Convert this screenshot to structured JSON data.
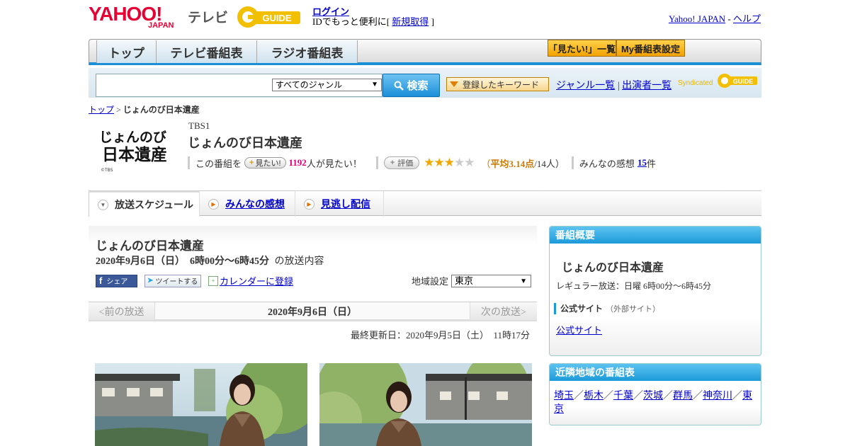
{
  "header": {
    "logo_yahoo": "YAHOO!",
    "logo_japan": "JAPAN",
    "logo_tv": "テレビ",
    "gguide": "GUIDE",
    "login": "ログイン",
    "id_text_before": "IDでもっと便利に[ ",
    "id_link": "新規取得",
    "id_text_after": " ]",
    "yahoo_japan": "Yahoo! JAPAN",
    "dash": " - ",
    "help": "ヘルプ"
  },
  "nav": {
    "tabs": [
      "トップ",
      "テレビ番組表",
      "ラジオ番組表"
    ],
    "mitai_list": "「見たい!」一覧",
    "my_settings": "My番組表設定"
  },
  "search": {
    "genre_select": "すべてのジャンル",
    "button": "検索",
    "keyword_btn": "登録したキーワード",
    "genre_list": "ジャンル一覧",
    "divider": " | ",
    "cast_list": "出演者一覧",
    "syndicated": "Syndicated"
  },
  "breadcrumb": {
    "home": "トップ",
    "sep": " > ",
    "current": "じょんのび日本遺産"
  },
  "program": {
    "logo_text": "じょんのび日本遺産",
    "copyright": "©TBS",
    "channel": "TBS1",
    "title": "じょんのび日本遺産",
    "this_program": "この番組を",
    "mitai_btn": "見たい!",
    "mitai_count": "1192",
    "mitai_suffix": "人が見たい！",
    "eval_btn": "評価",
    "rating": 3.14,
    "avg_open": "（",
    "avg_label": "平均3.14点",
    "avg_rest": "/14人）",
    "impressions_label": "みんなの感想",
    "impressions_count": "15",
    "impressions_unit": "件"
  },
  "tabs": {
    "schedule": "放送スケジュール",
    "impressions": "みんなの感想",
    "missed": "見逃し配信"
  },
  "main": {
    "title": "じょんのび日本遺産",
    "date_bold": "2020年9月6日（日）　6時00分～6時45分",
    "date_suffix": "の放送内容",
    "fb": "シェア",
    "tweet": "ツイートする",
    "calendar": "カレンダーに登録",
    "region_label": "地域設定",
    "region_value": "東京",
    "prev": "<前の放送",
    "current_date": "2020年9月6日（日）",
    "next": "次の放送>",
    "updated": "最終更新日：2020年9月5日（土）　11時17分"
  },
  "sidebar": {
    "overview_head": "番組概要",
    "overview_title": "じょんのび日本遺産",
    "regular": "レギュラー放送：日曜 6時00分～6時45分",
    "official_label": "公式サイト",
    "official_note": "（外部サイト）",
    "official_link": "公式サイト",
    "nearby_head": "近隣地域の番組表",
    "nearby": [
      "埼玉",
      "栃木",
      "千葉",
      "茨城",
      "群馬",
      "神奈川",
      "東京"
    ],
    "nearby_sep": "／"
  },
  "colors": {
    "accent_blue": "#1b8fd6",
    "yahoo_red": "#e60033",
    "star": "#f0a800",
    "pink": "#e0007a"
  }
}
